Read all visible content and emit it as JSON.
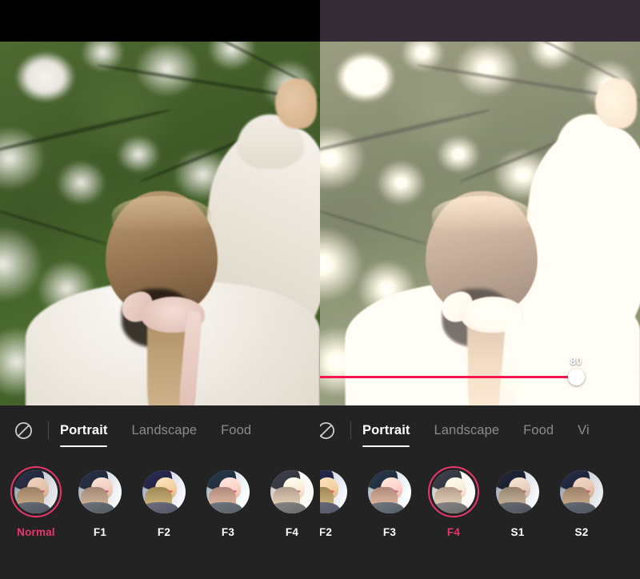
{
  "app": {
    "accent_color": "#e8376a",
    "slider_color": "#f5174e",
    "panel_background": "#232323"
  },
  "panels": [
    {
      "id": "before",
      "topbar_color": "#000000",
      "photo_filter": "none",
      "slider": {
        "visible": false,
        "value": null
      },
      "toolbar": {
        "no_filter_icon": "no-filter-icon",
        "tabs": [
          {
            "label": "Portrait",
            "active": true
          },
          {
            "label": "Landscape",
            "active": false
          },
          {
            "label": "Food",
            "active": false
          }
        ]
      },
      "filters": [
        {
          "label": "Normal",
          "grade": "g-normal",
          "selected": true
        },
        {
          "label": "F1",
          "grade": "g-f1",
          "selected": false
        },
        {
          "label": "F2",
          "grade": "g-f2",
          "selected": false
        },
        {
          "label": "F3",
          "grade": "g-f3",
          "selected": false
        },
        {
          "label": "F4",
          "grade": "g-f4",
          "selected": false
        }
      ]
    },
    {
      "id": "after",
      "topbar_color": "#362c38",
      "photo_filter": "f4",
      "slider": {
        "visible": true,
        "value": "80",
        "percent": 80
      },
      "toolbar": {
        "no_filter_icon": "no-filter-icon",
        "tabs": [
          {
            "label": "Portrait",
            "active": true
          },
          {
            "label": "Landscape",
            "active": false
          },
          {
            "label": "Food",
            "active": false
          },
          {
            "label": "Vi",
            "active": false
          }
        ]
      },
      "filters": [
        {
          "label": "F2",
          "grade": "g-f2",
          "selected": false
        },
        {
          "label": "F3",
          "grade": "g-f3",
          "selected": false
        },
        {
          "label": "F4",
          "grade": "g-f4",
          "selected": true
        },
        {
          "label": "S1",
          "grade": "g-s1",
          "selected": false
        },
        {
          "label": "S2",
          "grade": "g-s2",
          "selected": false
        }
      ]
    }
  ]
}
